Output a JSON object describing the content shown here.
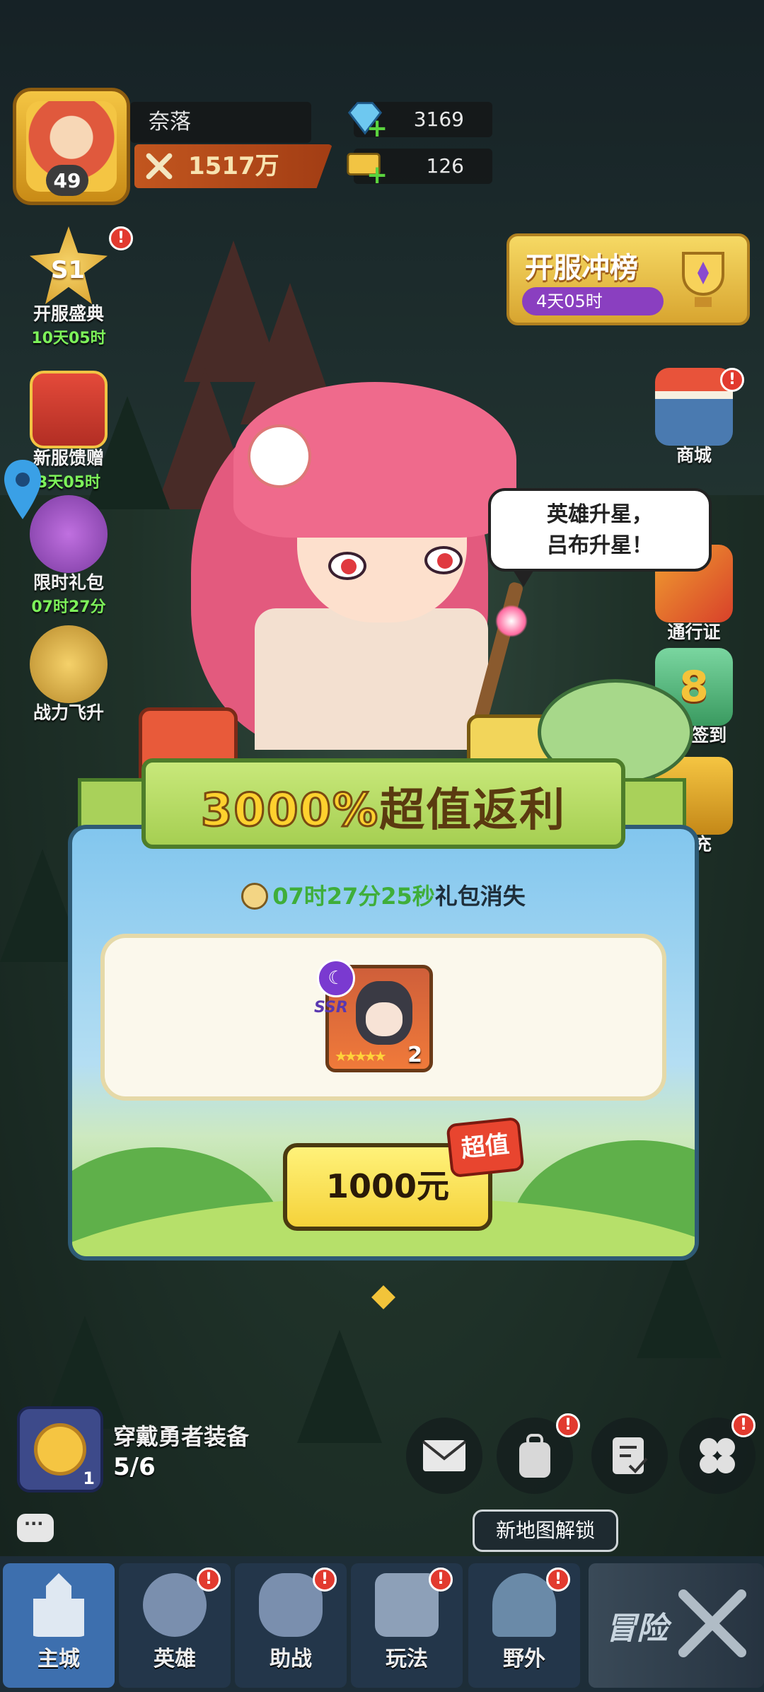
{
  "player": {
    "name": "奈落",
    "level": "49",
    "power": "1517万"
  },
  "resources": {
    "diamonds": "3169",
    "tickets": "126"
  },
  "left_side": [
    {
      "label": "开服盛典",
      "sub": "10天05时",
      "badge": "S1"
    },
    {
      "label": "新服馈赠",
      "sub": "3天05时"
    },
    {
      "label": "限时礼包",
      "sub": "07时27分"
    },
    {
      "label": "战力飞升",
      "sub": ""
    }
  ],
  "right_side": [
    {
      "label": "商城"
    },
    {
      "label": "通行证"
    },
    {
      "label": "8日签到"
    },
    {
      "label": "首充"
    }
  ],
  "rank_event": {
    "title": "开服冲榜",
    "time": "4天05时"
  },
  "character_speech": {
    "line1": "英雄升星，",
    "line2": "吕布升星！"
  },
  "offer": {
    "title_pct": "3000%",
    "title_text": "超值返利",
    "timer_value": "07时27分25秒",
    "timer_suffix": "礼包消失",
    "hero_rarity": "SSR",
    "hero_stars": "★★★★★",
    "hero_star_level": "2",
    "price": "1000元",
    "tag": "超值"
  },
  "quest": {
    "title": "穿戴勇者装备",
    "progress": "5/6",
    "count": "1"
  },
  "tooltip": "新地图解锁",
  "nav": [
    {
      "label": "主城",
      "active": true
    },
    {
      "label": "英雄"
    },
    {
      "label": "助战"
    },
    {
      "label": "玩法"
    },
    {
      "label": "野外"
    }
  ],
  "adventure_label": "冒险"
}
